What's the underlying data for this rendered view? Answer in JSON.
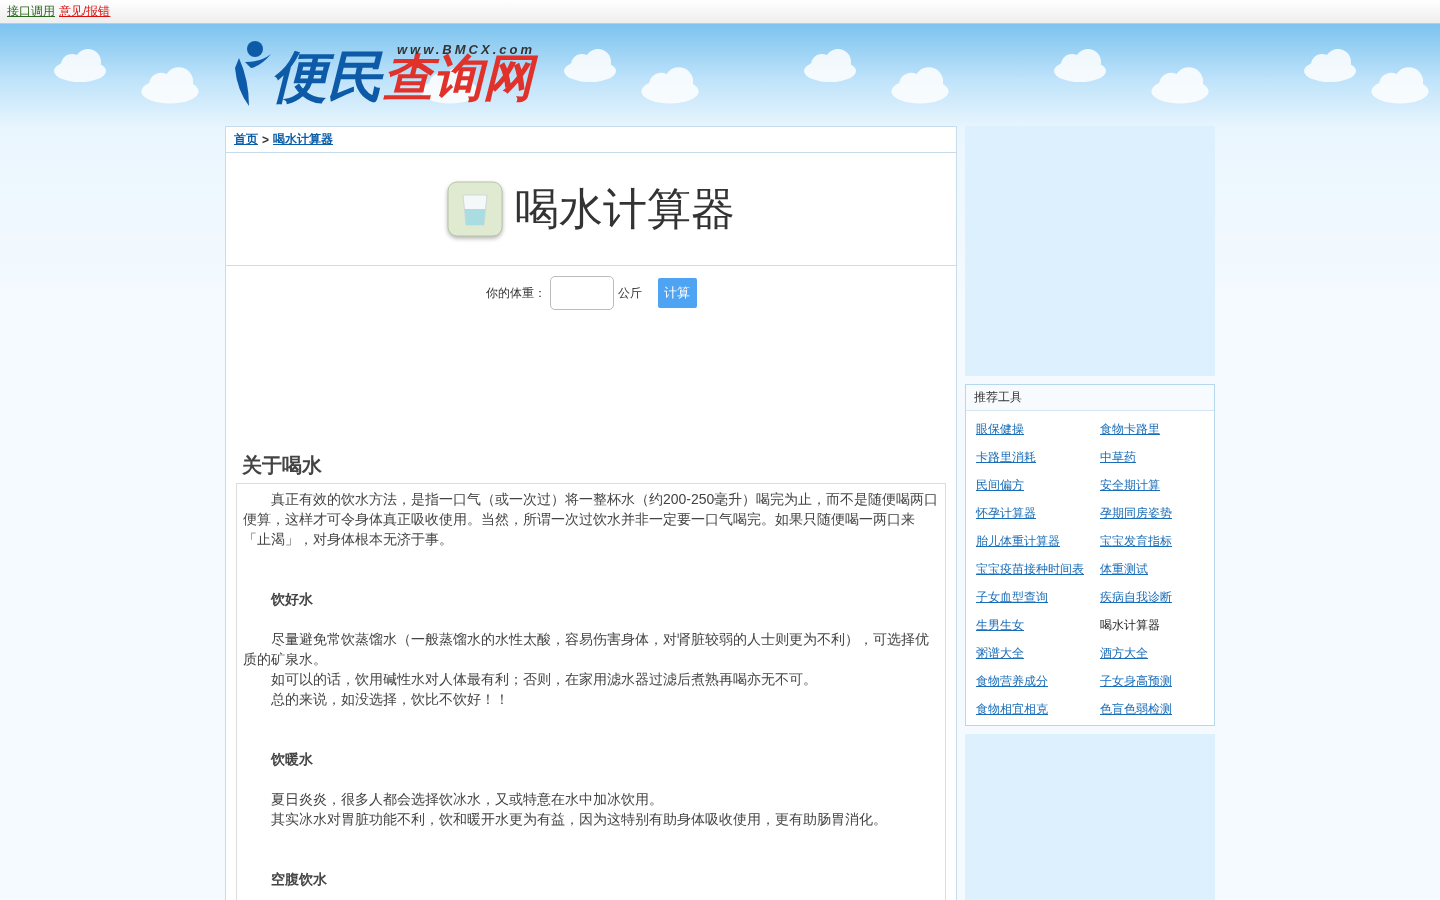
{
  "top_links": [
    {
      "label": "接口调用",
      "kind": "api"
    },
    {
      "label": "意见/报错",
      "kind": "feedback"
    }
  ],
  "logo": {
    "main": "便民",
    "accent": "查询网",
    "url": "www.BMCX.com"
  },
  "breadcrumb": [
    {
      "label": "首页"
    },
    {
      "label": "喝水计算器"
    }
  ],
  "breadcrumb_separator": ">",
  "title": "喝水计算器",
  "form": {
    "label": "你的体重：",
    "unit": "公斤",
    "button": "计算"
  },
  "article": {
    "heading": "关于喝水",
    "blocks": [
      {
        "kind": "text",
        "text": "真正有效的饮水方法，是指一口气（或一次过）将一整杯水（约200-250毫升）喝完为止，而不是随便喝两口便算，这样才可令身体真正吸收使用。当然，所谓一次过饮水并非一定要一口气喝完。如果只随便喝一两口来「止渴」，对身体根本无济于事。"
      },
      {
        "kind": "heading",
        "text": "饮好水"
      },
      {
        "kind": "text",
        "text": "尽量避免常饮蒸馏水（一般蒸馏水的水性太酸，容易伤害身体，对肾脏较弱的人士则更为不利），可选择优质的矿泉水。"
      },
      {
        "kind": "text",
        "text": "如可以的话，饮用碱性水对人体最有利；否则，在家用滤水器过滤后煮熟再喝亦无不可。"
      },
      {
        "kind": "text",
        "text": "总的来说，如没选择，饮比不饮好！！"
      },
      {
        "kind": "heading",
        "text": "饮暖水"
      },
      {
        "kind": "text",
        "text": "夏日炎炎，很多人都会选择饮冰水，又或特意在水中加冰饮用。"
      },
      {
        "kind": "text",
        "text": "其实冰水对胃脏功能不利，饮和暖开水更为有益，因为这特别有助身体吸收使用，更有助肠胃消化。"
      },
      {
        "kind": "heading",
        "text": "空腹饮水"
      }
    ]
  },
  "sidebar": {
    "title": "推荐工具",
    "items": [
      {
        "label": "眼保健操",
        "selected": false
      },
      {
        "label": "食物卡路里",
        "selected": false
      },
      {
        "label": "卡路里消耗",
        "selected": false
      },
      {
        "label": "中草药",
        "selected": false
      },
      {
        "label": "民间偏方",
        "selected": false
      },
      {
        "label": "安全期计算",
        "selected": false
      },
      {
        "label": "怀孕计算器",
        "selected": false
      },
      {
        "label": "孕期同房姿势",
        "selected": false
      },
      {
        "label": "胎儿体重计算器",
        "selected": false
      },
      {
        "label": "宝宝发育指标",
        "selected": false
      },
      {
        "label": "宝宝疫苗接种时间表",
        "selected": false
      },
      {
        "label": "体重测试",
        "selected": false
      },
      {
        "label": "子女血型查询",
        "selected": false
      },
      {
        "label": "疾病自我诊断",
        "selected": false
      },
      {
        "label": "生男生女",
        "selected": false
      },
      {
        "label": "喝水计算器",
        "selected": true
      },
      {
        "label": "粥谱大全",
        "selected": false
      },
      {
        "label": "酒方大全",
        "selected": false
      },
      {
        "label": "食物营养成分",
        "selected": false
      },
      {
        "label": "子女身高预测",
        "selected": false
      },
      {
        "label": "食物相宜相克",
        "selected": false
      },
      {
        "label": "色盲色弱检测",
        "selected": false
      }
    ]
  }
}
